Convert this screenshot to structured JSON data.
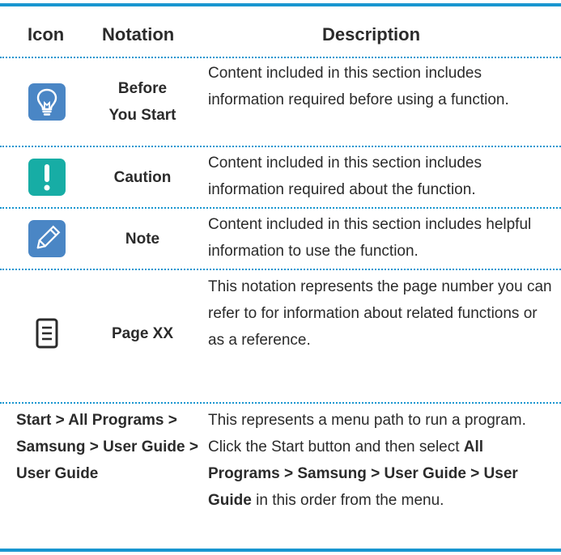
{
  "header": {
    "icon": "Icon",
    "notation": "Notation",
    "description": "Description"
  },
  "rows": [
    {
      "icon": "lightbulb-icon",
      "notation_line1": "Before",
      "notation_line2": "You Start",
      "description": "Content included in this section includes information required before using a function."
    },
    {
      "icon": "exclamation-icon",
      "notation": "Caution",
      "description": "Content included in this section includes information required about the function."
    },
    {
      "icon": "pencil-icon",
      "notation": "Note",
      "description": "Content included in this section includes helpful information to use the function."
    },
    {
      "icon": "document-icon",
      "notation": "Page XX",
      "description": "This notation represents the page number you can refer to for information about related functions or as a reference."
    }
  ],
  "menu_path_row": {
    "notation": "Start > All Programs > Samsung > User Guide > User Guide",
    "desc_part1": "This represents a menu path to run a program.",
    "desc_part2": "Click the Start button and then select ",
    "desc_bold": "All Programs > Samsung > User Guide > User Guide",
    "desc_part3": " in this order from the menu."
  },
  "colors": {
    "accent_blue": "#1996d0",
    "icon_blue": "#4a86c5",
    "icon_teal": "#17ada5"
  }
}
